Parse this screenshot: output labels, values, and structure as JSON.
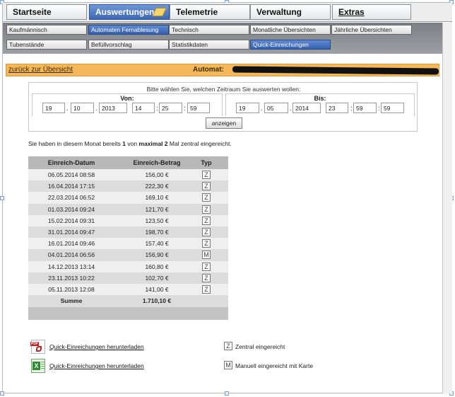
{
  "main_nav": {
    "tabs": [
      {
        "label": "Startseite"
      },
      {
        "label": "Auswertungen"
      },
      {
        "label": "Telemetrie"
      },
      {
        "label": "Verwaltung"
      },
      {
        "label": "Extras"
      }
    ]
  },
  "sub_nav": {
    "row1": [
      "Kaufmännisch",
      "Automaten Fernablesung",
      "Technisch",
      "Monatliche Übersichten",
      "Jährliche Übersichten"
    ],
    "row2": [
      "Tubenstände",
      "Befüllvorschlag",
      "Statistikdaten",
      "Quick-Einreichungen"
    ]
  },
  "back_bar": {
    "back_link": "zurück zur Übersicht",
    "automat_label": "Automat:"
  },
  "range": {
    "prompt": "Bitte wählen Sie, welchen Zeitraum Sie auswerten wollen:",
    "from_label": "Von:",
    "to_label": "Bis:",
    "from": {
      "day": "19",
      "month": "10",
      "year": "2013",
      "hour": "14",
      "minute": "25",
      "second": "59"
    },
    "to": {
      "day": "19",
      "month": "05",
      "year": "2014",
      "hour": "23",
      "minute": "59",
      "second": "59"
    },
    "show_button": "anzeigen"
  },
  "info": {
    "prefix": "Sie haben in diesem Monat bereits ",
    "count": "1",
    "middle": " von ",
    "max_label": "maximal 2",
    "suffix": " Mal zentral eingereicht."
  },
  "table": {
    "headers": [
      "Einreich-Datum",
      "Einreich-Betrag",
      "Typ"
    ],
    "rows": [
      {
        "date": "06.05.2014 08:58",
        "amount": "156,00 €",
        "type": "Z"
      },
      {
        "date": "16.04.2014 17:15",
        "amount": "222,30 €",
        "type": "Z"
      },
      {
        "date": "22.03.2014 06:52",
        "amount": "169,10 €",
        "type": "Z"
      },
      {
        "date": "01.03.2014 09:24",
        "amount": "121,70 €",
        "type": "Z"
      },
      {
        "date": "15.02.2014 09:31",
        "amount": "123,50 €",
        "type": "Z"
      },
      {
        "date": "31.01.2014 09:47",
        "amount": "198,70 €",
        "type": "Z"
      },
      {
        "date": "16.01.2014 09:46",
        "amount": "157,40 €",
        "type": "Z"
      },
      {
        "date": "04.01.2014 06:56",
        "amount": "156,90 €",
        "type": "M"
      },
      {
        "date": "14.12.2013 13:14",
        "amount": "160,80 €",
        "type": "Z"
      },
      {
        "date": "23.11.2013 10:22",
        "amount": "102,70 €",
        "type": "Z"
      },
      {
        "date": "05.11.2013 12:08",
        "amount": "141,00 €",
        "type": "Z"
      }
    ],
    "sum_label": "Summe",
    "sum_value": "1.710,10 €"
  },
  "downloads": {
    "pdf_label": "Quick-Einreichungen herunterladen",
    "xls_label": "Quick-Einreichungen herunterladen",
    "pdf_icon_text": "PDF"
  },
  "legend": {
    "z_icon": "Z",
    "z_label": "Zentral eingereicht",
    "m_icon": "M",
    "m_label": "Manuell eingereicht mit Karte"
  }
}
